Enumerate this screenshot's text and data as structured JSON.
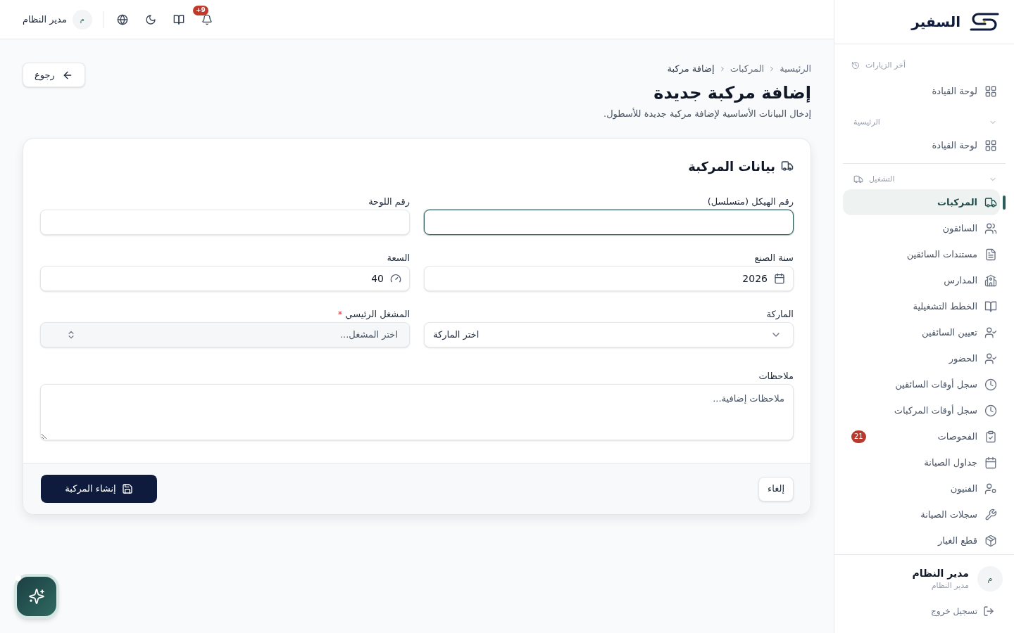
{
  "topbar": {
    "notification_count": "+9",
    "user": {
      "avatar": "م",
      "name": "مدير النظام"
    }
  },
  "sidebar": {
    "brand": "السفير",
    "recent": {
      "title": "أخر الزيارات",
      "items": [
        {
          "label": "لوحة القيادة",
          "selected": false
        }
      ]
    },
    "sections": [
      {
        "title": "الرئيسية",
        "expanded": true,
        "items": [
          {
            "label": "لوحة القيادة",
            "selected": false
          }
        ]
      },
      {
        "title": "التشغيل",
        "expanded": true,
        "items": [
          {
            "label": "المركبات",
            "selected": true
          },
          {
            "label": "السائقون",
            "selected": false
          },
          {
            "label": "مستندات السائقين",
            "selected": false
          },
          {
            "label": "المدارس",
            "selected": false
          },
          {
            "label": "الخطط التشغيلية",
            "selected": false
          },
          {
            "label": "تعيين السائقين",
            "selected": false
          },
          {
            "label": "الحضور",
            "selected": false
          },
          {
            "label": "سجل أوقات السائقين",
            "selected": false
          },
          {
            "label": "سجل أوقات المركبات",
            "selected": false
          },
          {
            "label": "الفحوصات",
            "selected": false,
            "badge": "21"
          },
          {
            "label": "جداول الصيانة",
            "selected": false
          },
          {
            "label": "الفنيون",
            "selected": false
          },
          {
            "label": "سجلات الصيانة",
            "selected": false
          },
          {
            "label": "قطع الغيار",
            "selected": false
          }
        ]
      }
    ],
    "user": {
      "avatar": "م",
      "name": "مدير النظام",
      "role": "مدير النظام"
    },
    "logout": "تسجيل خروج"
  },
  "breadcrumb": [
    "الرئيسية",
    "المركبات",
    "إضافة مركبة"
  ],
  "back_button": "رجوع",
  "page": {
    "title": "إضافة مركبة جديدة",
    "subtitle": "إدخال البيانات الأساسية لإضافة مركبة جديدة للأسطول."
  },
  "form": {
    "title": "بيانات المركبة",
    "fields": [
      {
        "kind": "text",
        "label": "رقم الهيكل (متسلسل)",
        "focused": true
      },
      {
        "kind": "text",
        "label": "رقم اللوحة",
        "focused": false
      },
      {
        "kind": "date",
        "label": "سنة الصنع",
        "value": "2026",
        "focused": false
      },
      {
        "kind": "number",
        "label": "السعة",
        "value": "40",
        "focused": false
      },
      {
        "kind": "select",
        "label": "الماركة",
        "placeholder": "اختر الماركة",
        "focused": false
      },
      {
        "kind": "combobox",
        "label": "المشغل الرئيسي",
        "required_mark": "*",
        "placeholder": "اختر المشغل...",
        "focused": false
      }
    ],
    "notes": {
      "label": "ملاحظات",
      "placeholder": "ملاحظات إضافية..."
    },
    "cancel_button": "إلغاء",
    "submit_button": "إنشاء المركبة"
  }
}
